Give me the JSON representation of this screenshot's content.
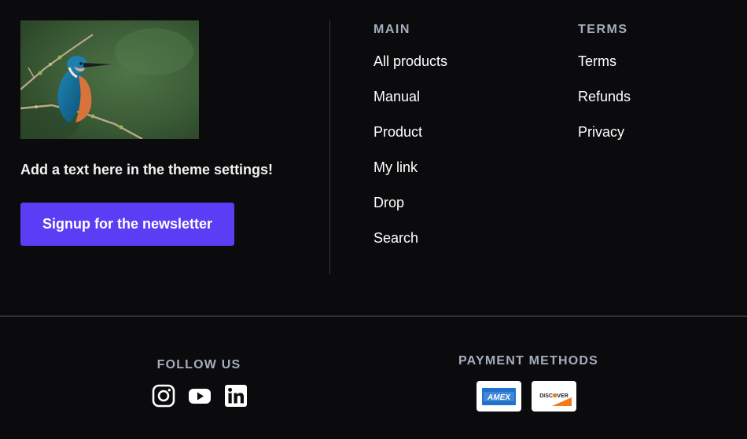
{
  "brand": {
    "tagline": "Add a text here in the theme settings!",
    "newsletter_label": "Signup for the newsletter",
    "accent": "#5b3df5"
  },
  "menus": {
    "main": {
      "heading": "MAIN",
      "items": [
        "All products",
        "Manual",
        "Product",
        "My link",
        "Drop",
        "Search"
      ]
    },
    "terms": {
      "heading": "TERMS",
      "items": [
        "Terms",
        "Refunds",
        "Privacy"
      ]
    }
  },
  "social": {
    "heading": "FOLLOW US",
    "icons": [
      "instagram-icon",
      "youtube-icon",
      "linkedin-icon"
    ]
  },
  "payments": {
    "heading": "PAYMENT METHODS",
    "cards": [
      {
        "icon": "amex-icon",
        "text": "AMEX"
      },
      {
        "icon": "discover-icon",
        "text": "DISCOVER"
      }
    ]
  }
}
